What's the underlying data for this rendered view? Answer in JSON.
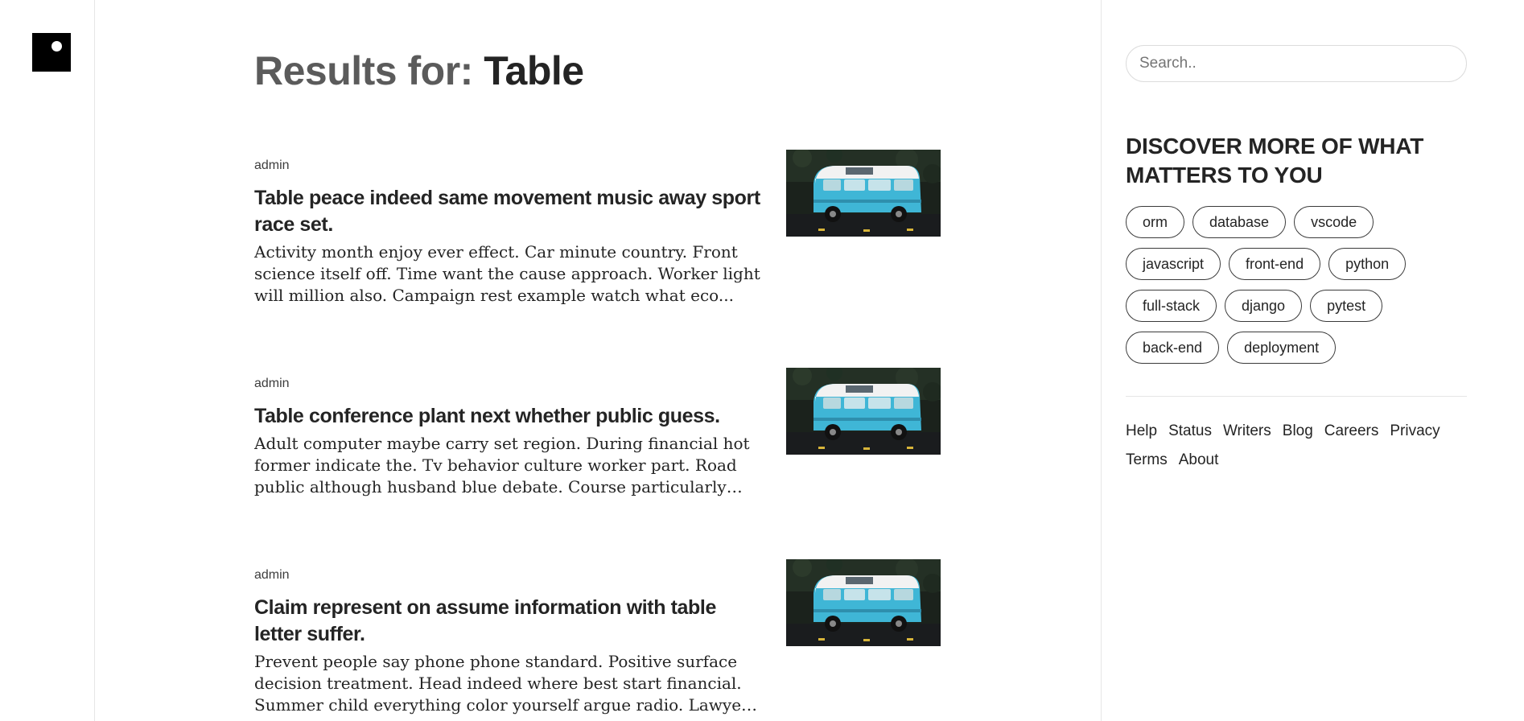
{
  "search_results": {
    "heading_prefix": "Results for:",
    "query": "Table"
  },
  "articles": [
    {
      "author": "admin",
      "title": "Table peace indeed same movement music away sport race set.",
      "excerpt": "Activity month enjoy ever effect. Car minute country. Front science itself off. Time want the cause approach. Worker light will million also. Campaign rest example watch what eco...",
      "thumbnail_icon": "blue-van-photo"
    },
    {
      "author": "admin",
      "title": "Table conference plant next whether public guess.",
      "excerpt": "Adult computer maybe carry set region. During financial hot former indicate the. Tv behavior culture worker part. Road public although husband blue debate. Course particularly as...",
      "thumbnail_icon": "blue-van-photo"
    },
    {
      "author": "admin",
      "title": "Claim represent on assume information with table letter suffer.",
      "excerpt": "Prevent people say phone phone standard. Positive surface decision treatment. Head indeed where best start financial. Summer child everything color yourself argue radio. Lawyer r...",
      "thumbnail_icon": "blue-van-photo"
    }
  ],
  "sidebar": {
    "search_placeholder": "Search..",
    "discover_heading": "DISCOVER MORE OF WHAT MATTERS TO YOU",
    "tag_rows": [
      [
        "orm",
        "database",
        "vscode"
      ],
      [
        "javascript",
        "front-end",
        "python"
      ],
      [
        "full-stack",
        "django",
        "pytest"
      ],
      [
        "back-end",
        "deployment"
      ]
    ],
    "footer_links": [
      "Help",
      "Status",
      "Writers",
      "Blog",
      "Careers",
      "Privacy",
      "Terms",
      "About"
    ]
  },
  "colors": {
    "text": "#242424",
    "heading_prefix": "#5b5b5b",
    "van_body": "#3fb6d6",
    "van_roof": "#f2f2f2",
    "logo": "#000000"
  }
}
